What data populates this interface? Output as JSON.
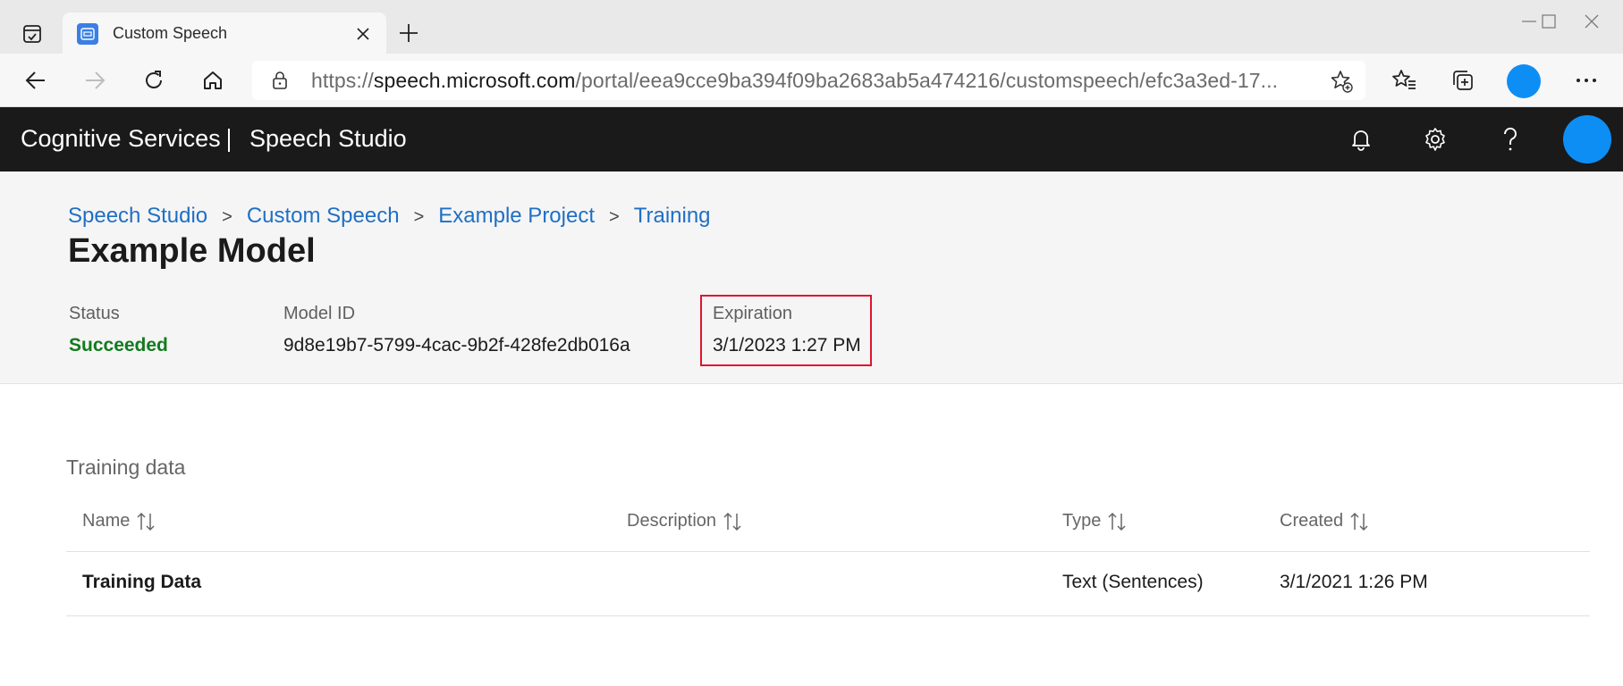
{
  "browser": {
    "tab": {
      "title": "Custom Speech"
    },
    "url": {
      "scheme": "https://",
      "host": "speech.microsoft.com",
      "path": "/portal/eea9cce9ba394f09ba2683ab5a474216/customspeech/efc3a3ed-17..."
    }
  },
  "app_header": {
    "brand": "Cognitive Services",
    "product": "Speech Studio"
  },
  "breadcrumb": [
    {
      "label": "Speech Studio"
    },
    {
      "label": "Custom Speech"
    },
    {
      "label": "Example Project"
    },
    {
      "label": "Training"
    }
  ],
  "breadcrumb_separator": ">",
  "page_title": "Example Model",
  "details": {
    "status": {
      "label": "Status",
      "value": "Succeeded",
      "color": "#127a1e"
    },
    "model_id": {
      "label": "Model ID",
      "value": "9d8e19b7-5799-4cac-9b2f-428fe2db016a"
    },
    "expiration": {
      "label": "Expiration",
      "value": "3/1/2023 1:27 PM",
      "highlight_color": "#e0142d"
    }
  },
  "training_data": {
    "title": "Training data",
    "columns": [
      "Name",
      "Description",
      "Type",
      "Created"
    ],
    "rows": [
      {
        "name": "Training Data",
        "description": "",
        "type": "Text (Sentences)",
        "created": "3/1/2021 1:26 PM"
      }
    ]
  },
  "colors": {
    "header_bg": "#1a1a1a",
    "link": "#1f6fc5",
    "accent_avatar": "#0d8ef5"
  },
  "icons": [
    "tab-actions-icon",
    "speech-favicon-icon",
    "close-icon",
    "plus-icon",
    "minimize-icon",
    "maximize-icon",
    "window-close-icon",
    "back-icon",
    "forward-icon",
    "refresh-icon",
    "home-icon",
    "lock-icon",
    "add-favorite-icon",
    "favorites-icon",
    "collections-icon",
    "more-icon",
    "bell-icon",
    "gear-icon",
    "help-icon",
    "sort-icon"
  ]
}
